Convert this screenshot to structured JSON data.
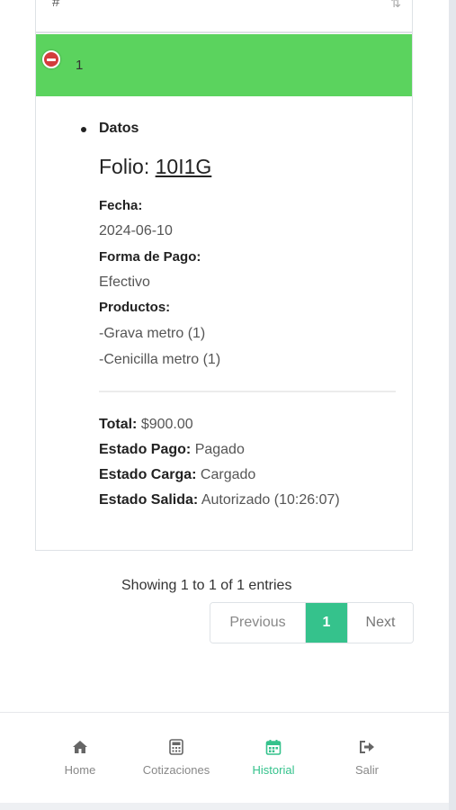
{
  "table": {
    "header_first_col": "#",
    "header_sort_icon": "sort-icon",
    "row": {
      "number": "1",
      "control_icon": "minus-circle-icon",
      "highlight_color": "#5bd35e"
    }
  },
  "details": {
    "section_label": "Datos",
    "folio_label": "Folio:",
    "folio_code": "10I1G",
    "fecha_label": "Fecha:",
    "fecha_value": "2024-06-10",
    "forma_pago_label": "Forma de Pago:",
    "forma_pago_value": "Efectivo",
    "productos_label": "Productos:",
    "productos": [
      "-Grava metro (1)",
      "-Cenicilla metro (1)"
    ],
    "total_label": "Total:",
    "total_value": "$900.00",
    "estado_pago_label": "Estado Pago:",
    "estado_pago_value": "Pagado",
    "estado_carga_label": "Estado Carga:",
    "estado_carga_value": "Cargado",
    "estado_salida_label": "Estado Salida:",
    "estado_salida_value": "Autorizado (10:26:07)"
  },
  "pagination": {
    "info": "Showing 1 to 1 of 1 entries",
    "previous": "Previous",
    "current": "1",
    "next": "Next",
    "accent": "#35c28c"
  },
  "bottom_nav": [
    {
      "label": "Home",
      "icon": "home-icon"
    },
    {
      "label": "Cotizaciones",
      "icon": "calculator-icon"
    },
    {
      "label": "Historial",
      "icon": "calendar-icon",
      "active": true
    },
    {
      "label": "Salir",
      "icon": "sign-out-icon"
    }
  ]
}
